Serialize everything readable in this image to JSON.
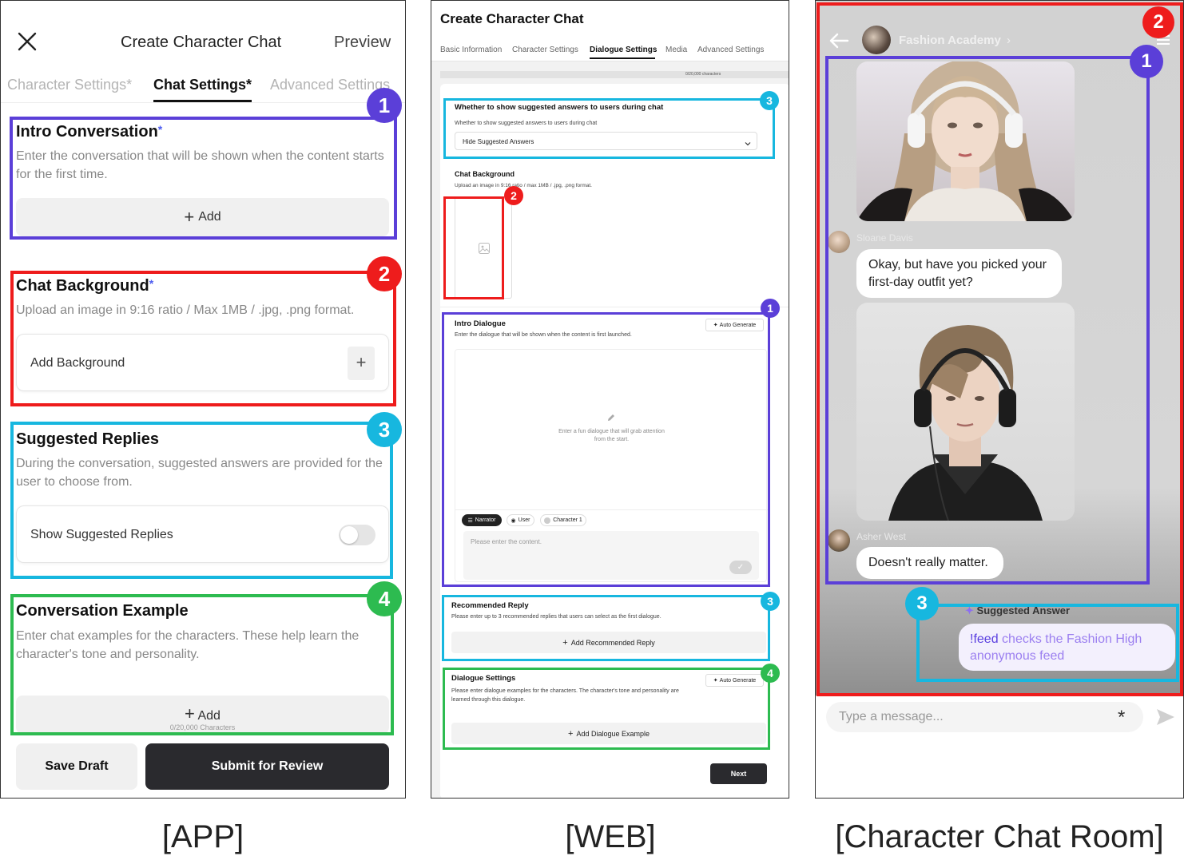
{
  "captions": {
    "app": "[APP]",
    "web": "[WEB]",
    "chat": "[Character Chat Room]"
  },
  "badges": {
    "one": "1",
    "two": "2",
    "three": "3",
    "four": "4"
  },
  "app": {
    "header_title": "Create Character Chat",
    "preview_label": "Preview",
    "tabs": [
      "Character Settings*",
      "Chat Settings*",
      "Advanced Settings"
    ],
    "intro": {
      "title": "Intro Conversation",
      "required_mark": "*",
      "description": "Enter the conversation that will be shown when the content starts for the first time.",
      "add_label": "Add"
    },
    "background": {
      "title": "Chat Background",
      "required_mark": "*",
      "description": "Upload an image in 9:16 ratio / Max 1MB / .jpg, .png format.",
      "add_label": "Add Background"
    },
    "suggested": {
      "title": "Suggested Replies",
      "description": "During the conversation, suggested answers are provided for the user to choose from.",
      "toggle_label": "Show Suggested Replies",
      "toggle_on": false
    },
    "example": {
      "title": "Conversation Example",
      "description": "Enter chat examples for the characters. These help learn the character's tone and personality.",
      "add_label": "Add",
      "counter": "0/20,000 Characters"
    },
    "save_draft": "Save Draft",
    "submit": "Submit for Review"
  },
  "web": {
    "title": "Create Character Chat",
    "tabs": [
      "Basic Information",
      "Character Settings",
      "Dialogue Settings",
      "Media",
      "Advanced Settings"
    ],
    "active_tab": "Dialogue Settings",
    "counter": "0/20,000 characters",
    "suggested": {
      "title": "Whether to show suggested answers to users during chat",
      "label": "Whether to show suggested answers to users during chat",
      "select_value": "Hide Suggested Answers"
    },
    "background": {
      "title": "Chat Background",
      "description": "Upload an image in 9:16 ratio / max 1MB / .jpg, .png format."
    },
    "intro": {
      "title": "Intro Dialogue",
      "description": "Enter the dialogue that will be shown when the content is first launched.",
      "auto_generate": "Auto Generate",
      "placeholder_line1": "Enter a fun dialogue that will grab attention",
      "placeholder_line2": "from the start.",
      "chips": [
        "Narrator",
        "User",
        "Character 1"
      ],
      "input_placeholder": "Please enter the content."
    },
    "recommended": {
      "title": "Recommended Reply",
      "description": "Please enter up to 3 recommended replies that users can select as the first dialogue.",
      "button": "Add Recommended Reply"
    },
    "dialogue": {
      "title": "Dialogue Settings",
      "description": "Please enter dialogue examples for the characters. The character's tone and personality are learned through this dialogue.",
      "auto_generate": "Auto Generate",
      "button": "Add Dialogue Example"
    },
    "next": "Next"
  },
  "chat": {
    "room_name": "Fashion Academy",
    "messages": [
      {
        "sender": "Sloane Davis",
        "text": "Okay, but have you picked your first-day outfit yet?"
      },
      {
        "sender": "Asher West",
        "text": "Doesn't really matter."
      }
    ],
    "suggested_label": "Suggested Answer",
    "suggested_command": "!feed",
    "suggested_text": " checks the Fashion High anonymous feed",
    "input_placeholder": "Type a message..."
  },
  "colors": {
    "purple": "#5b3fd8",
    "red": "#ee1c1c",
    "cyan": "#17b7df",
    "green": "#2dbb50",
    "dark_button": "#2a2a2e",
    "required": "#4c5cf0",
    "suggest_text": "#9b7ff0"
  },
  "icons": [
    "close-icon",
    "plus-icon",
    "image-placeholder-icon",
    "pencil-icon",
    "chevron-down-icon",
    "check-icon",
    "back-arrow-icon",
    "chevron-right-icon",
    "menu-icon",
    "sparkle-icon",
    "send-icon",
    "asterisk-icon",
    "avatar-icon"
  ]
}
